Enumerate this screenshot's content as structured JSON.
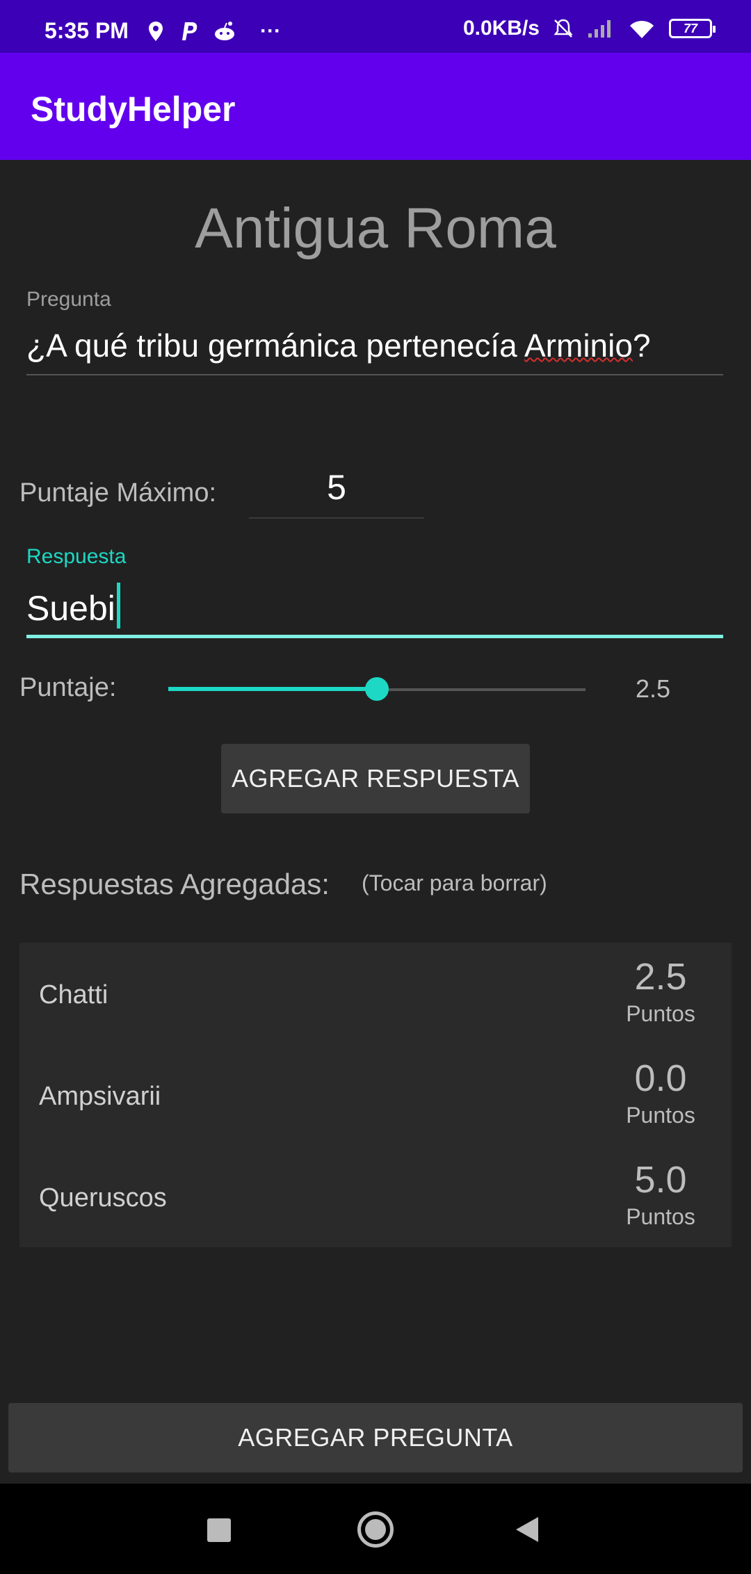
{
  "status_bar": {
    "time": "5:35 PM",
    "speed": "0.0KB/s",
    "battery": "77",
    "more": "···",
    "icons": [
      "location-icon",
      "paypal-icon",
      "reddit-icon",
      "mute-icon",
      "signal-icon",
      "wifi-icon",
      "battery-icon"
    ]
  },
  "app_bar": {
    "title": "StudyHelper"
  },
  "screen": {
    "title": "Antigua Roma",
    "question_label": "Pregunta",
    "question_value_before": "¿A qué tribu germánica pertenecía ",
    "question_value_misspelled": "Arminio",
    "question_value_after": "?",
    "max_score_label": "Puntaje Máximo:",
    "max_score_value": "5",
    "answer_label": "Respuesta",
    "answer_value": "Suebi",
    "score_label": "Puntaje:",
    "score_value": "2.5",
    "score_fraction": 0.5,
    "add_answer_button": "AGREGAR RESPUESTA",
    "answers_header": "Respuestas Agregadas:",
    "answers_hint": "(Tocar para borrar)",
    "answers": [
      {
        "name": "Chatti",
        "points": "2.5",
        "unit": "Puntos"
      },
      {
        "name": "Ampsivarii",
        "points": "0.0",
        "unit": "Puntos"
      },
      {
        "name": "Queruscos",
        "points": "5.0",
        "unit": "Puntos"
      }
    ],
    "add_question_button": "AGREGAR PREGUNTA"
  },
  "colors": {
    "status_bar": "#3c00b6",
    "app_bar": "#6200ee",
    "accent": "#1dd8c4",
    "background": "#212121"
  }
}
